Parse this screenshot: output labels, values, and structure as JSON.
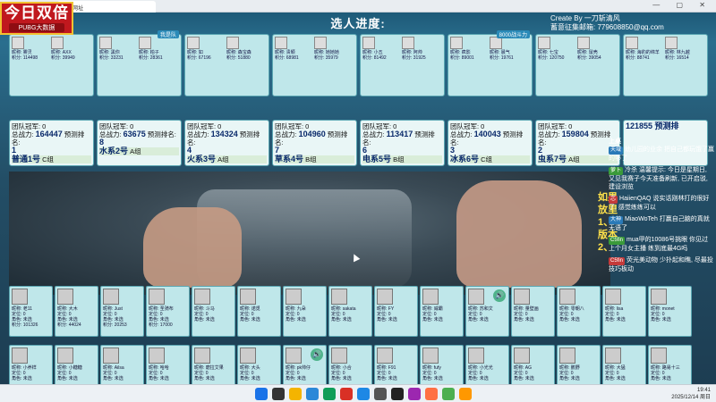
{
  "browser": {
    "tab_title": "选人网址",
    "controls": "— ▢ ✕"
  },
  "logo": {
    "title": "今日双倍",
    "subtitle": "PUBG大数据"
  },
  "header": {
    "title": "选人进度:",
    "credit_line1": "Create By 一刀斩清风",
    "credit_line2": "蓄意征集邮箱: 779608850@qq.com"
  },
  "teams": [
    {
      "group": "普通1号",
      "score": "164447",
      "team_label": "团队冠军: 0",
      "total_label": "总战力:",
      "predict_label": "预测排名:",
      "rank": "1",
      "group_label": "C组",
      "tag": "",
      "members": [
        {
          "name": "雾灵",
          "score": "114498"
        },
        {
          "name": "AXX",
          "score": "39949"
        }
      ]
    },
    {
      "group": "水系2号",
      "score": "63675",
      "team_label": "团队冠军: 0",
      "total_label": "总战力:",
      "predict_label": "预测排名:",
      "rank": "8",
      "group_label": "A组",
      "tag": "我是队",
      "members": [
        {
          "name": "黑你",
          "score": "33231"
        },
        {
          "name": "柏子",
          "score": "28361"
        }
      ]
    },
    {
      "group": "火系3号",
      "score": "134324",
      "team_label": "团队冠军: 0",
      "total_label": "总战力:",
      "predict_label": "预测排名:",
      "rank": "4",
      "group_label": "A组",
      "tag": "",
      "members": [
        {
          "name": "如",
          "score": "67196"
        },
        {
          "name": "森宝森",
          "score": "51880"
        }
      ]
    },
    {
      "group": "草系4号",
      "score": "104960",
      "team_label": "团队冠军: 0",
      "total_label": "总战力:",
      "predict_label": "预测排名:",
      "rank": "7",
      "group_label": "B组",
      "tag": "",
      "members": [
        {
          "name": "贵颖",
          "score": "68981"
        },
        {
          "name": "她她她",
          "score": "35979"
        }
      ]
    },
    {
      "group": "电系5号",
      "score": "113417",
      "team_label": "团队冠军: 0",
      "total_label": "总战力:",
      "predict_label": "预测排名:",
      "rank": "6",
      "group_label": "B组",
      "tag": "",
      "members": [
        {
          "name": "小五",
          "score": "81492"
        },
        {
          "name": "阿帅",
          "score": "31925"
        }
      ]
    },
    {
      "group": "冰系6号",
      "score": "140043",
      "team_label": "团队冠军: 0",
      "total_label": "总战力:",
      "predict_label": "预测排名:",
      "rank": "3",
      "group_label": "C组",
      "tag": "8000战斗力",
      "members": [
        {
          "name": "疯影",
          "score": "89001"
        },
        {
          "name": "晨气",
          "score": "19761"
        }
      ]
    },
    {
      "group": "虫系7号",
      "score": "159804",
      "team_label": "团队冠军: 0",
      "total_label": "总战力:",
      "predict_label": "预测排名:",
      "rank": "2",
      "group_label": "A组",
      "tag": "",
      "members": [
        {
          "name": "七宝",
          "score": "120750"
        },
        {
          "name": "鼠壳",
          "score": "39054"
        }
      ]
    }
  ],
  "extra_card": {
    "members": [
      {
        "name": "海豹的绵羊",
        "score": "88741"
      },
      {
        "name": "林九越",
        "score": "16514"
      }
    ],
    "group": "",
    "score": "121855",
    "predict_label": "预测排"
  },
  "row2_tags": [
    "",
    "我子",
    "",
    "一步暴不暗",
    "OG战队队",
    "",
    "",
    ""
  ],
  "row2_names": [
    [
      "macaad",
      "青城"
    ],
    [
      "初初",
      "漏水小仔"
    ],
    [
      "郭影",
      "阳满"
    ],
    [
      "汪汪",
      "芒果"
    ],
    [
      "鸭子",
      "聚十二"
    ],
    [
      "小越",
      "和和"
    ],
    [
      "牛子",
      "雨萧"
    ],
    [
      "小光子",
      "雷蛇"
    ]
  ],
  "players_row1": [
    {
      "name": "老11",
      "score": "101326"
    },
    {
      "name": "大木",
      "score": "44024"
    },
    {
      "name": "Just",
      "score": "20253"
    },
    {
      "name": "圣骑布",
      "score": "17000"
    },
    {
      "name": "斗马",
      "score": ""
    },
    {
      "name": "诺觅",
      "score": ""
    },
    {
      "name": "九朵",
      "score": ""
    },
    {
      "name": "sakata",
      "score": ""
    },
    {
      "name": "FY",
      "score": ""
    },
    {
      "name": "威霸",
      "score": ""
    },
    {
      "name": "苏和文",
      "score": ""
    },
    {
      "name": "量壁画",
      "score": ""
    },
    {
      "name": "零朝八",
      "score": ""
    },
    {
      "name": "lisa",
      "score": ""
    },
    {
      "name": "monet",
      "score": ""
    }
  ],
  "players_row2": [
    {
      "name": "小养样"
    },
    {
      "name": "小糖糖"
    },
    {
      "name": "Ailsa"
    },
    {
      "name": "哈哈"
    },
    {
      "name": "磨拉艾果"
    },
    {
      "name": "大头"
    },
    {
      "name": "pk帅仔"
    },
    {
      "name": "小合"
    },
    {
      "name": "F91"
    },
    {
      "name": "fufy"
    },
    {
      "name": "小光光"
    },
    {
      "name": "AG"
    },
    {
      "name": "鹏野"
    },
    {
      "name": "大猛"
    },
    {
      "name": "路易十三"
    }
  ],
  "chat": {
    "header": "上桌",
    "messages": [
      {
        "badge": "天域",
        "text": "幼儿园的业余 把自己都玩饿了赢的够了"
      },
      {
        "badge": "萝卜",
        "text": "冷杀 温馨提示: 今日是星期日, 又见我赛子今天准备刷新, 已开启驳, 建设浏览"
      },
      {
        "badge": "芯",
        "text": "HaiienQAQ 说实话刚林打的很好了, 感觉练练可以"
      },
      {
        "badge": "大神",
        "text": "MiaoWoTeh 打赢自己脑的真就无语了"
      },
      {
        "badge": "C5fin",
        "text": "mua甲的10086号挑眼 你见过上个月女主播 练到底最4G吗"
      },
      {
        "badge": "C5fin",
        "text": "荧光美动物 少扑起和瞧, 尽最投技巧板动"
      }
    ]
  },
  "overlay": {
    "line1": "如果",
    "line2": "放里",
    "line3": "1、",
    "line4": "版本",
    "line5": "2、"
  },
  "taskbar": {
    "time": "19:41",
    "date": "2025/12/14 周日"
  },
  "colors": {
    "card": "#bfe7ea",
    "border": "#5aa6b2",
    "logo_red": "#c0181e"
  }
}
